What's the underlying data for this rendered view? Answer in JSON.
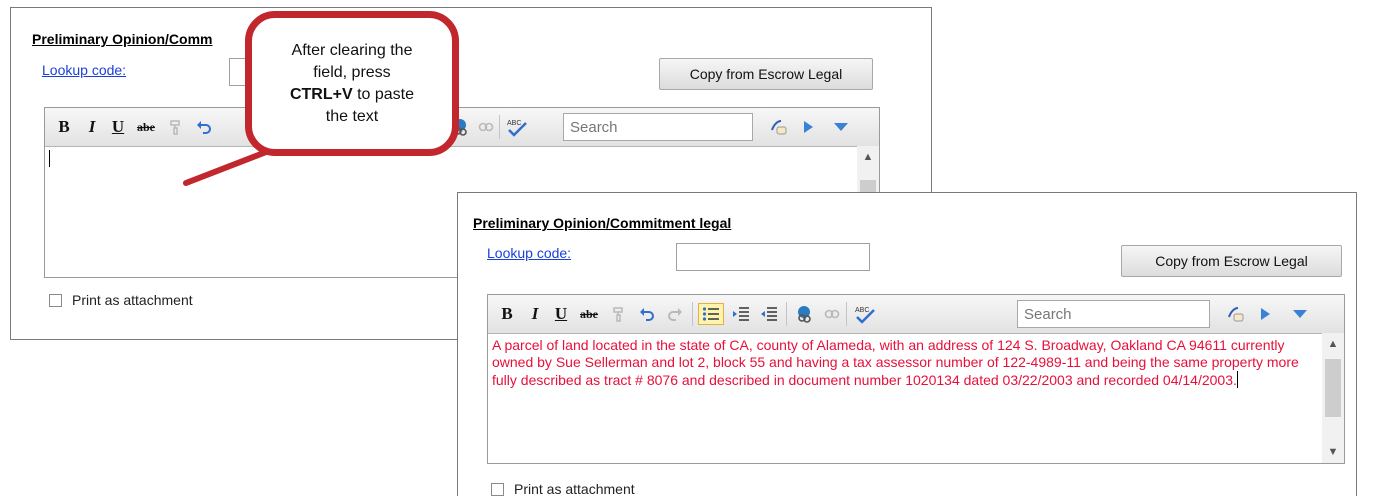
{
  "back": {
    "title": "Preliminary Opinion/Comm",
    "lookup_label": "Lookup code:",
    "copy_button": "Copy from Escrow Legal",
    "search_placeholder": "Search",
    "print_label": "Print as attachment"
  },
  "front": {
    "title": "Preliminary Opinion/Commitment legal",
    "lookup_label": "Lookup code:",
    "copy_button": "Copy from Escrow Legal",
    "search_placeholder": "Search",
    "legal_text": "A parcel of land located in the state of CA, county of Alameda, with an address of 124 S. Broadway, Oakland CA 94611 currently owned by Sue Sellerman and lot 2, block 55 and having a tax assessor number of 122-4989-11 and being the same property more fully described as tract # 8076 and described in document number 1020134 dated 03/22/2003 and recorded 04/14/2003.",
    "print_label": "Print as attachment"
  },
  "callout": {
    "line1": "After clearing the",
    "line2": "field, press",
    "key": "CTRL+V",
    "line3_rest": " to paste",
    "line4": "the text"
  },
  "colors": {
    "callout_border": "#c1272d",
    "legal_text": "#e8103a",
    "link": "#1a3fd6"
  },
  "icons": {
    "bold": "bold-icon",
    "italic": "italic-icon",
    "underline": "underline-icon",
    "strike": "strikethrough-icon",
    "format": "format-painter-icon",
    "undo": "undo-icon",
    "redo": "redo-icon",
    "bullets": "bullet-list-icon",
    "indent": "indent-icon",
    "outdent": "outdent-icon",
    "link": "insert-link-icon",
    "unlink": "remove-link-icon",
    "spell": "spell-check-icon",
    "eraser": "eraser-icon",
    "next": "play-next-icon",
    "menu": "dropdown-arrow-icon"
  }
}
